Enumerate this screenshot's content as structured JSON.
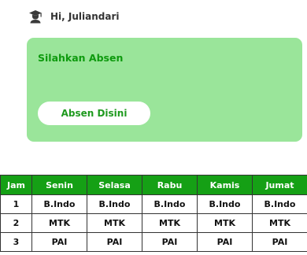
{
  "header": {
    "greeting": "Hi, Juliandari",
    "avatar_icon": "graduate-user-icon"
  },
  "card": {
    "title": "Silahkan Absen",
    "button_label": "Absen Disini"
  },
  "colors": {
    "card_bg": "#9ae59a",
    "title_green": "#0e9a0e",
    "table_header_bg": "#15a015"
  },
  "schedule": {
    "columns": [
      "Jam",
      "Senin",
      "Selasa",
      "Rabu",
      "Kamis",
      "Jumat"
    ],
    "rows": [
      [
        "1",
        "B.Indo",
        "B.Indo",
        "B.Indo",
        "B.Indo",
        "B.Indo"
      ],
      [
        "2",
        "MTK",
        "MTK",
        "MTK",
        "MTK",
        "MTK"
      ],
      [
        "3",
        "PAI",
        "PAI",
        "PAI",
        "PAI",
        "PAI"
      ]
    ]
  }
}
